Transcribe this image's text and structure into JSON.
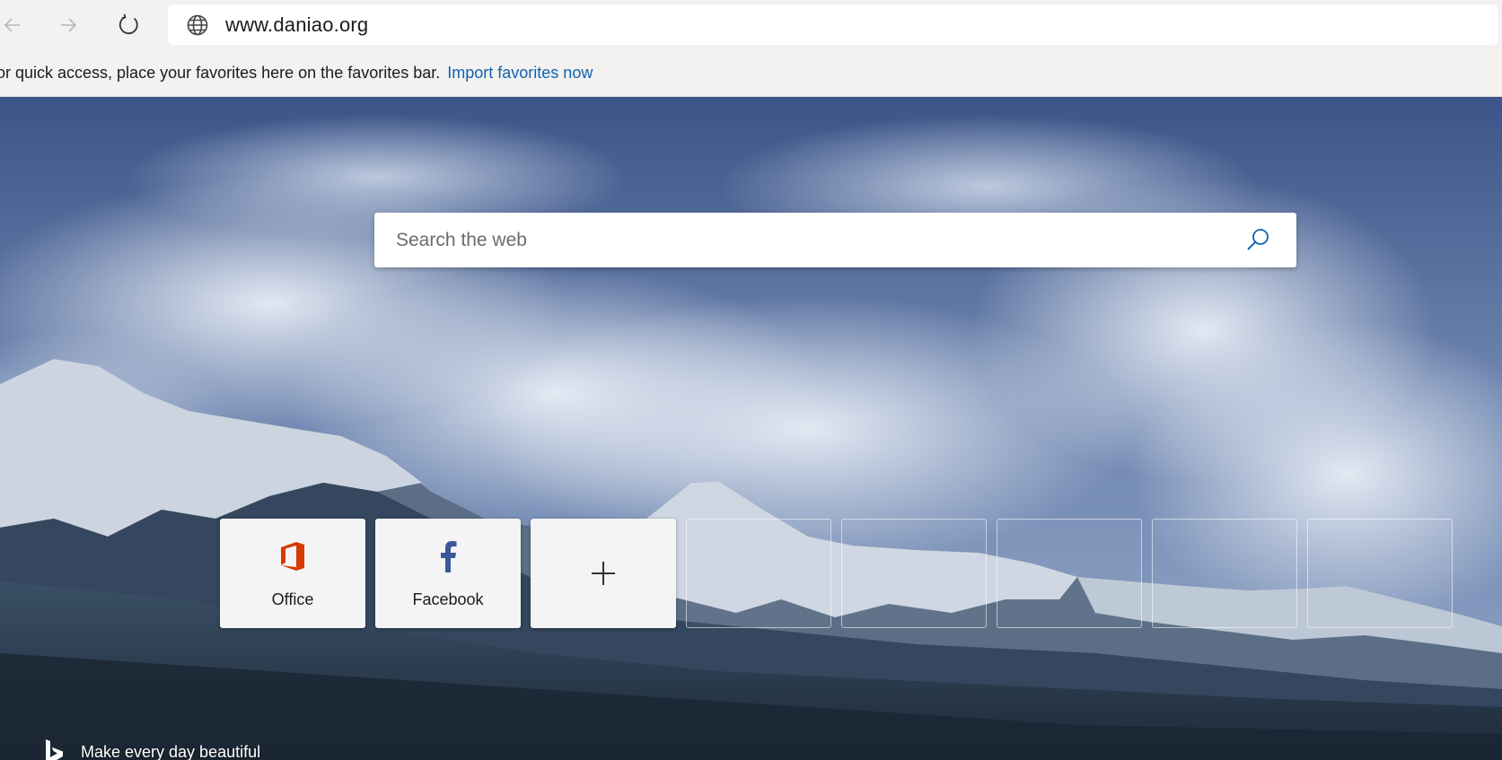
{
  "toolbar": {
    "url": "www.daniao.org"
  },
  "favorites_bar": {
    "message": "or quick access, place your favorites here on the favorites bar.",
    "import_link": "Import favorites now"
  },
  "search": {
    "placeholder": "Search the web"
  },
  "tiles": [
    {
      "label": "Office",
      "icon": "office-icon",
      "color": "#d83b01"
    },
    {
      "label": "Facebook",
      "icon": "facebook-icon",
      "color": "#3b5998"
    },
    {
      "label": "",
      "icon": "plus-icon"
    }
  ],
  "footer": {
    "tagline": "Make every day beautiful",
    "icon": "bing-icon"
  },
  "colors": {
    "accent": "#0f62b0",
    "toolbar_bg": "#f3f2f1"
  }
}
